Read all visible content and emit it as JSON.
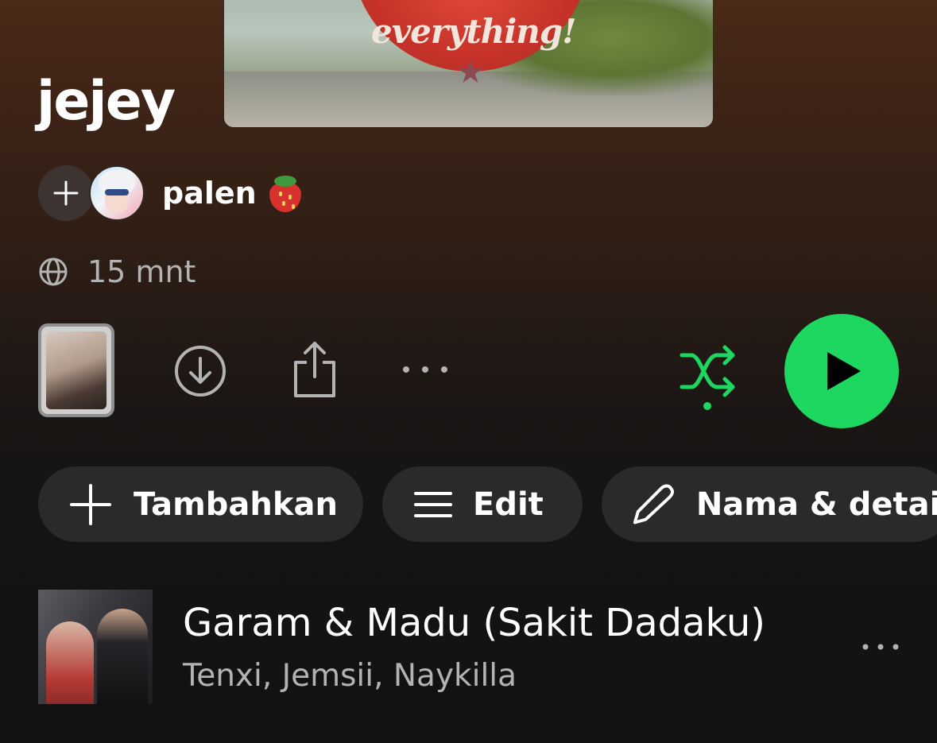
{
  "playlist": {
    "cover_text": "everything!",
    "title": "jejey",
    "owner": {
      "name": "palen",
      "emoji": "🍓"
    },
    "visibility_icon": "globe-icon",
    "duration": "15 mnt"
  },
  "controls": {
    "download_icon": "download-icon",
    "share_icon": "share-icon",
    "more_icon": "more-icon",
    "shuffle_icon": "shuffle-icon",
    "play_icon": "play-icon",
    "accent_color": "#1ed760"
  },
  "chips": {
    "add_label": "Tambahkan",
    "edit_label": "Edit",
    "details_label": "Nama & detail"
  },
  "tracks": [
    {
      "title": "Garam & Madu (Sakit Dadaku)",
      "artists": "Tenxi, Jemsii, Naykilla"
    }
  ]
}
